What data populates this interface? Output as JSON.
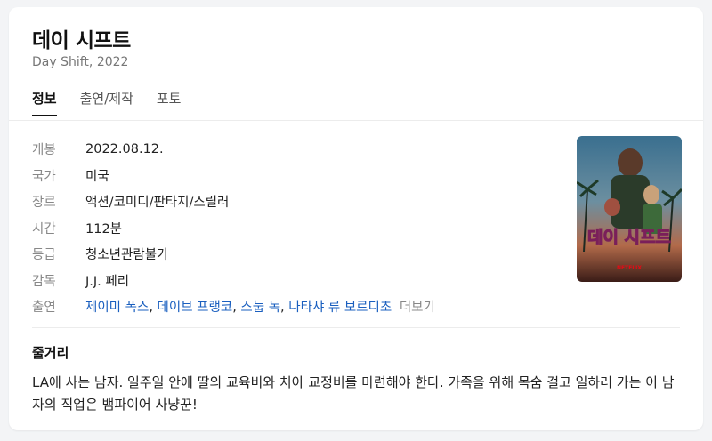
{
  "movie": {
    "title": "데이 시프트",
    "subtitle": "Day Shift, 2022"
  },
  "tabs": [
    "정보",
    "출연/제작",
    "포토"
  ],
  "info": {
    "release": {
      "label": "개봉",
      "value": "2022.08.12."
    },
    "country": {
      "label": "국가",
      "value": "미국"
    },
    "genre": {
      "label": "장르",
      "value": "액션/코미디/판타지/스릴러"
    },
    "runtime": {
      "label": "시간",
      "value": "112분"
    },
    "rating": {
      "label": "등급",
      "value": "청소년관람불가"
    },
    "director": {
      "label": "감독",
      "value": "J.J. 페리"
    },
    "cast": {
      "label": "출연",
      "names": [
        "제이미 폭스",
        "데이브 프랭코",
        "스눕 독",
        "나타샤 류 보르디초"
      ],
      "separator": ", ",
      "more": "더보기"
    }
  },
  "poster": {
    "title_text": "데이 시프트",
    "brand": "NETFLIX"
  },
  "synopsis": {
    "title": "줄거리",
    "text": "LA에 사는 남자. 일주일 안에 딸의 교육비와 치아 교정비를 마련해야 한다. 가족을 위해 목숨 걸고 일하러 가는 이 남자의 직업은 뱀파이어 사냥꾼!"
  }
}
